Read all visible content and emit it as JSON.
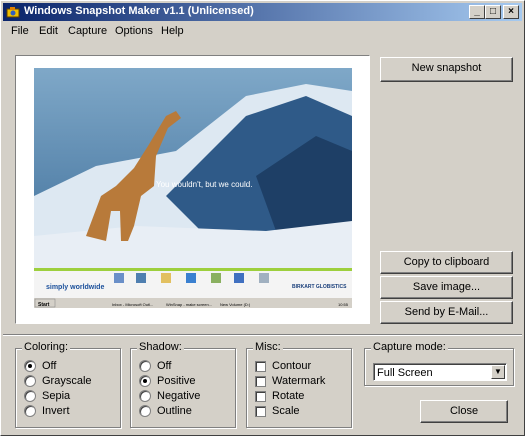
{
  "window": {
    "title": "Windows Snapshot Maker v1.1 (Unlicensed)"
  },
  "titlebar_buttons": {
    "minimize": "_",
    "maximize": "□",
    "close": "×"
  },
  "menu": [
    "File",
    "Edit",
    "Capture",
    "Options",
    "Help"
  ],
  "preview": {
    "caption": "You wouldn't, but we could.",
    "brand": "simply worldwide",
    "company": "BIRKART GLOBISTICS",
    "desktop_icons": [
      "My Computer",
      "My Network Places",
      "My Documents",
      "Internet Explorer",
      "Notepad++",
      "MSN",
      "Recycle Bin"
    ],
    "taskbar": {
      "start": "Start",
      "items": [
        "Inbox - Microsoft Outl...",
        "WinSnap - make screen...",
        "New Volume (D:)"
      ],
      "clock": "10:55"
    }
  },
  "buttons": {
    "new_snapshot": "New snapshot",
    "copy_clipboard": "Copy to clipboard",
    "save_image": "Save image...",
    "send_email": "Send by E-Mail...",
    "close": "Close"
  },
  "coloring": {
    "legend": "Coloring:",
    "options": [
      "Off",
      "Grayscale",
      "Sepia",
      "Invert"
    ],
    "selected": "Off"
  },
  "shadow": {
    "legend": "Shadow:",
    "options": [
      "Off",
      "Positive",
      "Negative",
      "Outline"
    ],
    "selected": "Positive"
  },
  "misc": {
    "legend": "Misc:",
    "options": [
      "Contour",
      "Watermark",
      "Rotate",
      "Scale"
    ]
  },
  "capture_mode": {
    "legend": "Capture mode:",
    "value": "Full Screen"
  },
  "colors": {
    "title_start": "#0a246a",
    "title_end": "#a6caf0",
    "face": "#d4d0c8"
  }
}
